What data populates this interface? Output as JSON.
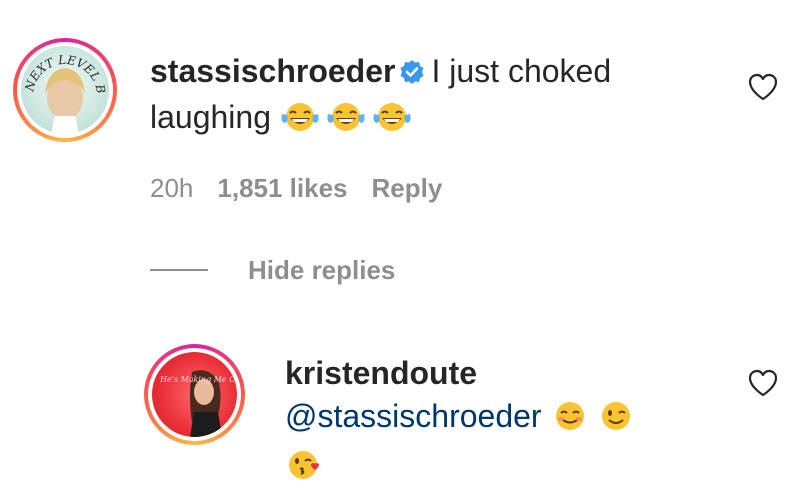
{
  "comments": [
    {
      "username": "stassischroeder",
      "verified": true,
      "text": "I just choked laughing",
      "emojis": [
        "face-with-tears-of-joy",
        "face-with-tears-of-joy",
        "face-with-tears-of-joy"
      ],
      "time": "20h",
      "likes": "1,851 likes",
      "reply_label": "Reply",
      "avatar_text": "NEXT LEVEL BASIC"
    }
  ],
  "replies_toggle": {
    "label": "Hide replies"
  },
  "replies": [
    {
      "username": "kristendoute",
      "mention": "@stassischroeder",
      "emojis": [
        "smiling-face",
        "winking-face",
        "face-blowing-a-kiss"
      ],
      "avatar_text": "He's Making Me Crazy"
    }
  ],
  "colors": {
    "text": "#262626",
    "muted": "#8e8e8e",
    "mention": "#00376b",
    "verified": "#3897f0"
  }
}
